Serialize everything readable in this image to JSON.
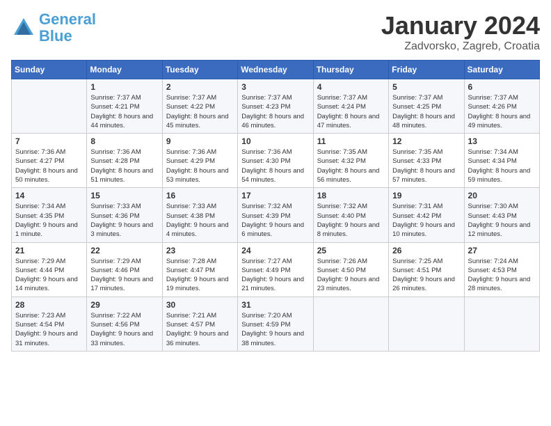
{
  "header": {
    "logo_line1": "General",
    "logo_line2": "Blue",
    "month": "January 2024",
    "location": "Zadvorsko, Zagreb, Croatia"
  },
  "weekdays": [
    "Sunday",
    "Monday",
    "Tuesday",
    "Wednesday",
    "Thursday",
    "Friday",
    "Saturday"
  ],
  "weeks": [
    [
      {
        "day": "",
        "sunrise": "",
        "sunset": "",
        "daylight": ""
      },
      {
        "day": "1",
        "sunrise": "Sunrise: 7:37 AM",
        "sunset": "Sunset: 4:21 PM",
        "daylight": "Daylight: 8 hours and 44 minutes."
      },
      {
        "day": "2",
        "sunrise": "Sunrise: 7:37 AM",
        "sunset": "Sunset: 4:22 PM",
        "daylight": "Daylight: 8 hours and 45 minutes."
      },
      {
        "day": "3",
        "sunrise": "Sunrise: 7:37 AM",
        "sunset": "Sunset: 4:23 PM",
        "daylight": "Daylight: 8 hours and 46 minutes."
      },
      {
        "day": "4",
        "sunrise": "Sunrise: 7:37 AM",
        "sunset": "Sunset: 4:24 PM",
        "daylight": "Daylight: 8 hours and 47 minutes."
      },
      {
        "day": "5",
        "sunrise": "Sunrise: 7:37 AM",
        "sunset": "Sunset: 4:25 PM",
        "daylight": "Daylight: 8 hours and 48 minutes."
      },
      {
        "day": "6",
        "sunrise": "Sunrise: 7:37 AM",
        "sunset": "Sunset: 4:26 PM",
        "daylight": "Daylight: 8 hours and 49 minutes."
      }
    ],
    [
      {
        "day": "7",
        "sunrise": "Sunrise: 7:36 AM",
        "sunset": "Sunset: 4:27 PM",
        "daylight": "Daylight: 8 hours and 50 minutes."
      },
      {
        "day": "8",
        "sunrise": "Sunrise: 7:36 AM",
        "sunset": "Sunset: 4:28 PM",
        "daylight": "Daylight: 8 hours and 51 minutes."
      },
      {
        "day": "9",
        "sunrise": "Sunrise: 7:36 AM",
        "sunset": "Sunset: 4:29 PM",
        "daylight": "Daylight: 8 hours and 53 minutes."
      },
      {
        "day": "10",
        "sunrise": "Sunrise: 7:36 AM",
        "sunset": "Sunset: 4:30 PM",
        "daylight": "Daylight: 8 hours and 54 minutes."
      },
      {
        "day": "11",
        "sunrise": "Sunrise: 7:35 AM",
        "sunset": "Sunset: 4:32 PM",
        "daylight": "Daylight: 8 hours and 56 minutes."
      },
      {
        "day": "12",
        "sunrise": "Sunrise: 7:35 AM",
        "sunset": "Sunset: 4:33 PM",
        "daylight": "Daylight: 8 hours and 57 minutes."
      },
      {
        "day": "13",
        "sunrise": "Sunrise: 7:34 AM",
        "sunset": "Sunset: 4:34 PM",
        "daylight": "Daylight: 8 hours and 59 minutes."
      }
    ],
    [
      {
        "day": "14",
        "sunrise": "Sunrise: 7:34 AM",
        "sunset": "Sunset: 4:35 PM",
        "daylight": "Daylight: 9 hours and 1 minute."
      },
      {
        "day": "15",
        "sunrise": "Sunrise: 7:33 AM",
        "sunset": "Sunset: 4:36 PM",
        "daylight": "Daylight: 9 hours and 3 minutes."
      },
      {
        "day": "16",
        "sunrise": "Sunrise: 7:33 AM",
        "sunset": "Sunset: 4:38 PM",
        "daylight": "Daylight: 9 hours and 4 minutes."
      },
      {
        "day": "17",
        "sunrise": "Sunrise: 7:32 AM",
        "sunset": "Sunset: 4:39 PM",
        "daylight": "Daylight: 9 hours and 6 minutes."
      },
      {
        "day": "18",
        "sunrise": "Sunrise: 7:32 AM",
        "sunset": "Sunset: 4:40 PM",
        "daylight": "Daylight: 9 hours and 8 minutes."
      },
      {
        "day": "19",
        "sunrise": "Sunrise: 7:31 AM",
        "sunset": "Sunset: 4:42 PM",
        "daylight": "Daylight: 9 hours and 10 minutes."
      },
      {
        "day": "20",
        "sunrise": "Sunrise: 7:30 AM",
        "sunset": "Sunset: 4:43 PM",
        "daylight": "Daylight: 9 hours and 12 minutes."
      }
    ],
    [
      {
        "day": "21",
        "sunrise": "Sunrise: 7:29 AM",
        "sunset": "Sunset: 4:44 PM",
        "daylight": "Daylight: 9 hours and 14 minutes."
      },
      {
        "day": "22",
        "sunrise": "Sunrise: 7:29 AM",
        "sunset": "Sunset: 4:46 PM",
        "daylight": "Daylight: 9 hours and 17 minutes."
      },
      {
        "day": "23",
        "sunrise": "Sunrise: 7:28 AM",
        "sunset": "Sunset: 4:47 PM",
        "daylight": "Daylight: 9 hours and 19 minutes."
      },
      {
        "day": "24",
        "sunrise": "Sunrise: 7:27 AM",
        "sunset": "Sunset: 4:49 PM",
        "daylight": "Daylight: 9 hours and 21 minutes."
      },
      {
        "day": "25",
        "sunrise": "Sunrise: 7:26 AM",
        "sunset": "Sunset: 4:50 PM",
        "daylight": "Daylight: 9 hours and 23 minutes."
      },
      {
        "day": "26",
        "sunrise": "Sunrise: 7:25 AM",
        "sunset": "Sunset: 4:51 PM",
        "daylight": "Daylight: 9 hours and 26 minutes."
      },
      {
        "day": "27",
        "sunrise": "Sunrise: 7:24 AM",
        "sunset": "Sunset: 4:53 PM",
        "daylight": "Daylight: 9 hours and 28 minutes."
      }
    ],
    [
      {
        "day": "28",
        "sunrise": "Sunrise: 7:23 AM",
        "sunset": "Sunset: 4:54 PM",
        "daylight": "Daylight: 9 hours and 31 minutes."
      },
      {
        "day": "29",
        "sunrise": "Sunrise: 7:22 AM",
        "sunset": "Sunset: 4:56 PM",
        "daylight": "Daylight: 9 hours and 33 minutes."
      },
      {
        "day": "30",
        "sunrise": "Sunrise: 7:21 AM",
        "sunset": "Sunset: 4:57 PM",
        "daylight": "Daylight: 9 hours and 36 minutes."
      },
      {
        "day": "31",
        "sunrise": "Sunrise: 7:20 AM",
        "sunset": "Sunset: 4:59 PM",
        "daylight": "Daylight: 9 hours and 38 minutes."
      },
      {
        "day": "",
        "sunrise": "",
        "sunset": "",
        "daylight": ""
      },
      {
        "day": "",
        "sunrise": "",
        "sunset": "",
        "daylight": ""
      },
      {
        "day": "",
        "sunrise": "",
        "sunset": "",
        "daylight": ""
      }
    ]
  ]
}
